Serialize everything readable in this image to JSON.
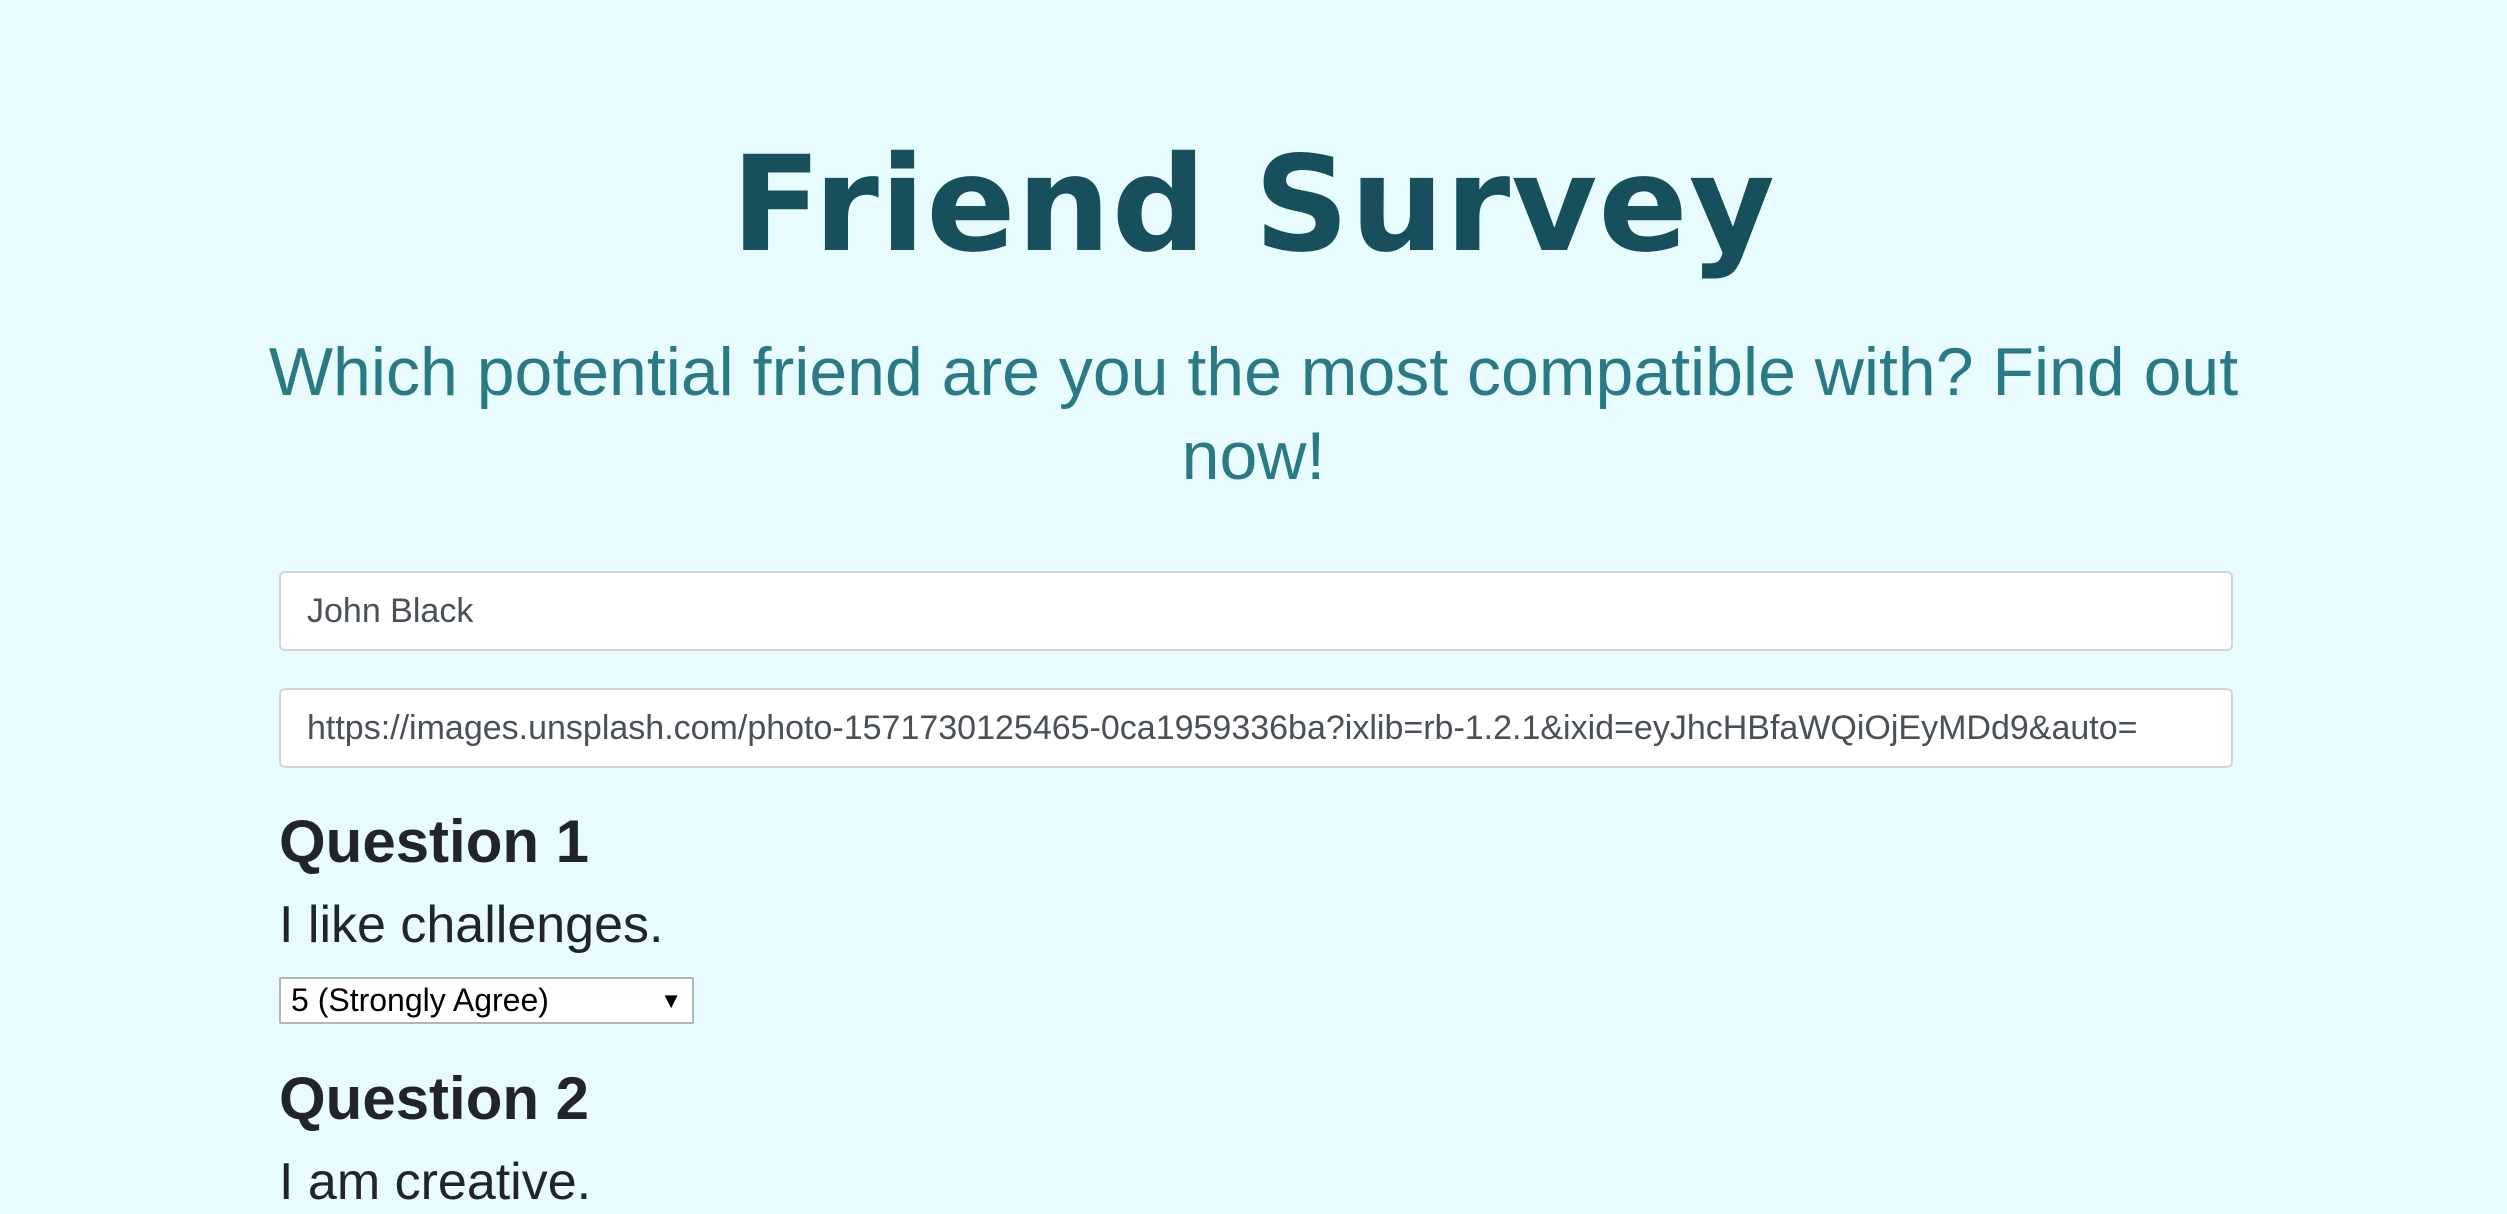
{
  "header": {
    "title": "Friend Survey",
    "subtitle": "Which potential friend are you the most compatible with? Find out now!"
  },
  "form": {
    "name": {
      "value": "John Black"
    },
    "photo": {
      "value": "https://images.unsplash.com/photo-1571730125465-0ca1959336ba?ixlib=rb-1.2.1&ixid=eyJhcHBfaWQiOjEyMDd9&auto="
    }
  },
  "questions": [
    {
      "title": "Question 1",
      "text": "I like challenges.",
      "selected": "5 (Strongly Agree)"
    },
    {
      "title": "Question 2",
      "text": "I am creative."
    }
  ],
  "icons": {
    "dropdown": "chevron-down-icon"
  },
  "colors": {
    "background": "#e8fbff",
    "title": "#174f5c",
    "subtitle": "#2a7a85",
    "text": "#212529"
  }
}
